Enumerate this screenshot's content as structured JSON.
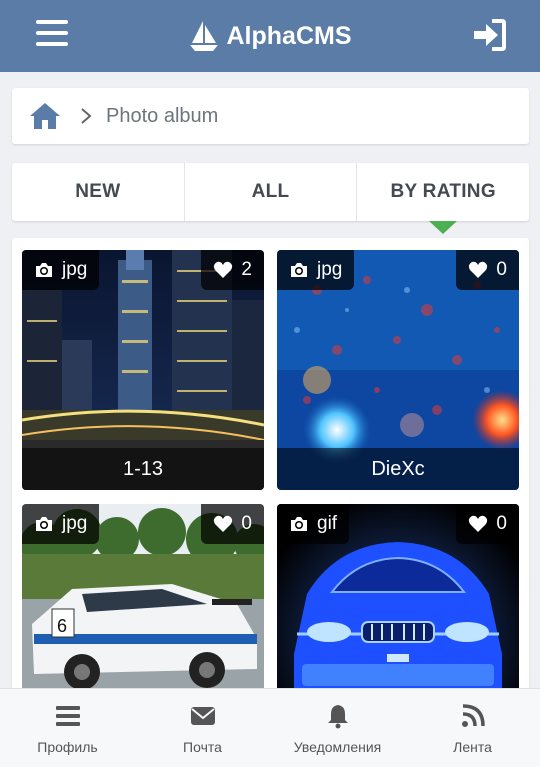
{
  "header": {
    "brand": "AlphaCMS",
    "icons": [
      "hamburger-menu-icon",
      "sailboat-logo-icon",
      "sign-in-icon"
    ]
  },
  "breadcrumb": {
    "home_icon": "home-icon",
    "separator_icon": "chevron-right-icon",
    "current": "Photo album"
  },
  "tabs": [
    {
      "label": "NEW",
      "active": false
    },
    {
      "label": "ALL",
      "active": false
    },
    {
      "label": "BY RATING",
      "active": true
    }
  ],
  "photos": [
    {
      "type": "jpg",
      "likes": "2",
      "caption": "1-13"
    },
    {
      "type": "jpg",
      "likes": "0",
      "caption": "DieXc"
    },
    {
      "type": "jpg",
      "likes": "0",
      "caption": ""
    },
    {
      "type": "gif",
      "likes": "0",
      "caption": ""
    }
  ],
  "bottom_nav": [
    {
      "label": "Профиль",
      "icon": "profile-list-icon"
    },
    {
      "label": "Почта",
      "icon": "mail-icon"
    },
    {
      "label": "Уведомления",
      "icon": "bell-icon"
    },
    {
      "label": "Лента",
      "icon": "rss-feed-icon"
    }
  ],
  "colors": {
    "header_bg": "#5a7ca6",
    "active_indicator": "#4caf50",
    "page_bg": "#eef0f3"
  }
}
